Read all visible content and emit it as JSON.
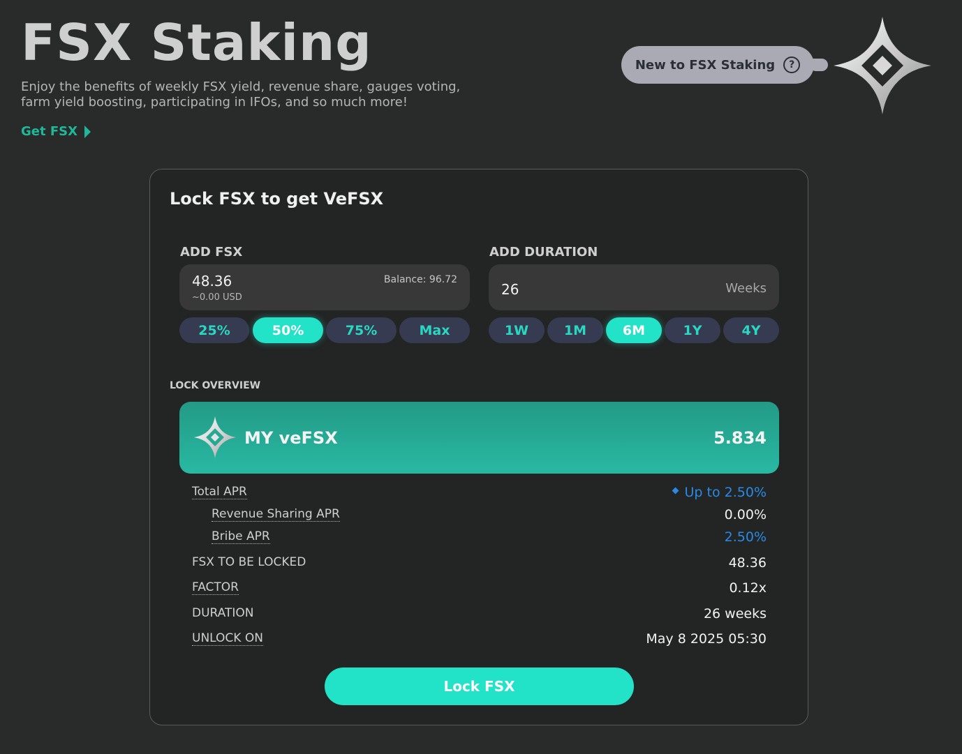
{
  "header": {
    "title": "FSX Staking",
    "subtitle": "Enjoy the benefits of weekly FSX yield, revenue share, gauges voting, farm yield boosting, participating in IFOs, and so much more!",
    "get_link": "Get FSX",
    "help_label": "New to FSX Staking",
    "help_icon_text": "?"
  },
  "card": {
    "title": "Lock FSX to get VeFSX",
    "add_fsx": {
      "label": "ADD FSX",
      "value": "48.36",
      "usd": "~0.00 USD",
      "balance": "Balance: 96.72",
      "percents": [
        "25%",
        "50%",
        "75%",
        "Max"
      ],
      "selected": "50%"
    },
    "add_duration": {
      "label": "ADD DURATION",
      "value": "26",
      "unit": "Weeks",
      "options": [
        "1W",
        "1M",
        "6M",
        "1Y",
        "4Y"
      ],
      "selected": "6M"
    },
    "overview": {
      "label": "LOCK OVERVIEW",
      "my_vefsx_label": "MY veFSX",
      "my_vefsx_value": "5.834",
      "rows": {
        "total_apr": {
          "label": "Total APR",
          "value": "Up to 2.50%"
        },
        "revenue_apr": {
          "label": "Revenue Sharing APR",
          "value": "0.00%"
        },
        "bribe_apr": {
          "label": "Bribe APR",
          "value": "2.50%"
        },
        "to_lock": {
          "label": "FSX TO BE LOCKED",
          "value": "48.36"
        },
        "factor": {
          "label": "FACTOR",
          "value": "0.12x"
        },
        "duration": {
          "label": "DURATION",
          "value": "26 weeks"
        },
        "unlock": {
          "label": "UNLOCK ON",
          "value": "May 8 2025 05:30"
        }
      }
    },
    "lock_button": "Lock FSX"
  },
  "colors": {
    "background": "#282b2a",
    "accent": "#22e2c8",
    "link": "#1fb89a",
    "apr_blue": "#2a8be6",
    "chip_bg": "#373b52"
  },
  "icons": [
    "chevron-right-icon",
    "question-circle-icon",
    "fsx-star-logo-icon"
  ]
}
